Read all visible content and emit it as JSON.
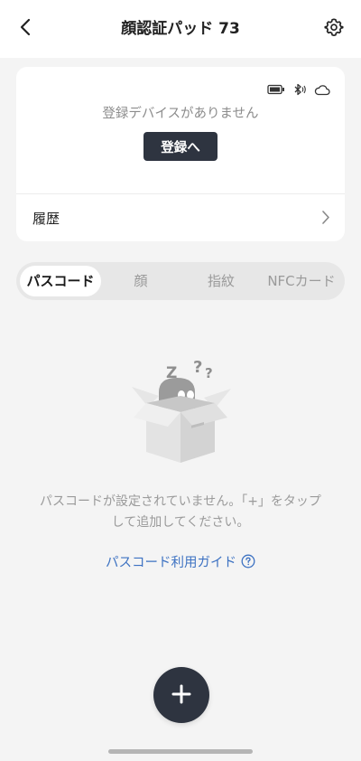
{
  "header": {
    "title": "顔認証パッド 73",
    "back_icon": "chevron-left-icon",
    "settings_icon": "gear-icon"
  },
  "device_card": {
    "status_icons": [
      "battery-icon",
      "bluetooth-icon",
      "cloud-icon"
    ],
    "no_device_text": "登録デバイスがありません",
    "register_button": "登録へ",
    "history_label": "履歴",
    "history_icon": "chevron-right-icon"
  },
  "tabs": [
    {
      "label": "パスコード",
      "active": true
    },
    {
      "label": "顔",
      "active": false
    },
    {
      "label": "指紋",
      "active": false
    },
    {
      "label": "NFCカード",
      "active": false
    }
  ],
  "empty_state": {
    "illustration": "empty-box-icon",
    "message_line1": "パスコードが設定されていません。「+」をタップ",
    "message_line2": "して追加してください。",
    "guide_link": "パスコード利用ガイド",
    "guide_icon": "help-circle-icon"
  },
  "fab": {
    "icon": "plus-icon"
  },
  "colors": {
    "background": "#f4f4f4",
    "card": "#ffffff",
    "primary_dark": "#2e3440",
    "link": "#3d72c2",
    "muted_text": "#9a9a9a"
  }
}
